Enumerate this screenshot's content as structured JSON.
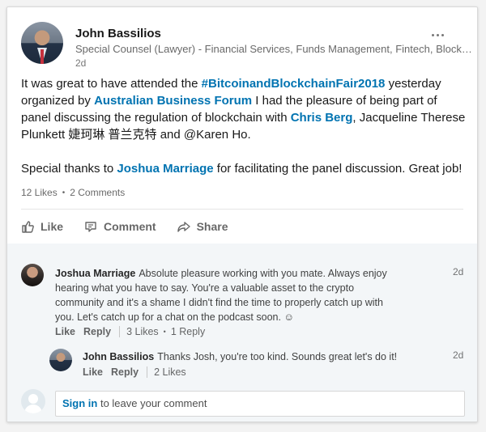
{
  "post": {
    "author_name": "John Bassilios",
    "author_title": "Special Counsel (Lawyer) - Financial Services, Funds Management, Fintech, Blockchain",
    "time": "2d",
    "text": {
      "t1": "It was great to have attended the ",
      "hashtag": "#BitcoinandBlockchainFair2018",
      "t2": " yesterday organized by ",
      "org": "Australian Business Forum",
      "t3": " I had the pleasure of being part of panel discussing the regulation of blockchain with ",
      "person1": "Chris Berg",
      "t4": ", Jacqueline Therese Plunkett  婕珂琳 普兰克特 and @Karen Ho.",
      "t5": "Special thanks to ",
      "person2": "Joshua Marriage",
      "t6": " for facilitating the panel discussion. Great job!"
    },
    "likes": "12 Likes",
    "comments_count": "2 Comments"
  },
  "actions": {
    "like": "Like",
    "comment": "Comment",
    "share": "Share"
  },
  "comments": [
    {
      "author": "Joshua Marriage",
      "text": "Absolute pleasure working with you mate. Always enjoy hearing what you have to say. You're a valuable asset to the crypto community and it's a shame I didn't find the time to properly catch up with you. Let's catch up for a chat on the podcast soon. ☺",
      "time": "2d",
      "like": "Like",
      "reply": "Reply",
      "likes": "3 Likes",
      "replies": "1 Reply"
    },
    {
      "author": "John Bassilios",
      "text": "Thanks Josh, you're too kind. Sounds great let's do it!",
      "time": "2d",
      "like": "Like",
      "reply": "Reply",
      "likes": "2 Likes"
    }
  ],
  "signin": {
    "link": "Sign in",
    "text": " to leave your comment"
  }
}
